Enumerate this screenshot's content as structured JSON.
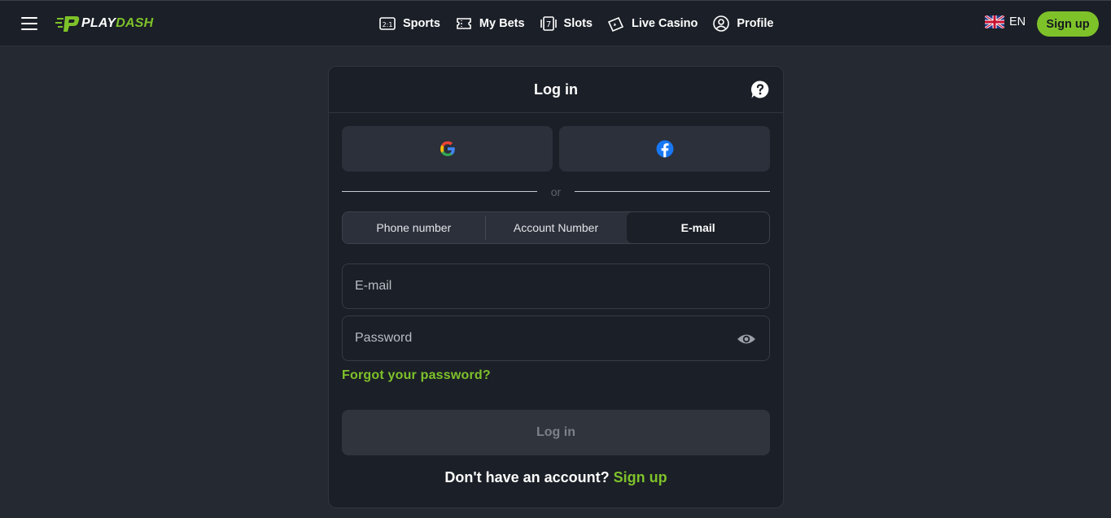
{
  "header": {
    "logo_text_play": "PLAY",
    "logo_text_dash": "DASH",
    "nav": [
      {
        "label": "Sports",
        "icon": "sports-icon"
      },
      {
        "label": "My Bets",
        "icon": "ticket-icon"
      },
      {
        "label": "Slots",
        "icon": "slots-icon"
      },
      {
        "label": "Live Casino",
        "icon": "cards-icon"
      },
      {
        "label": "Profile",
        "icon": "profile-icon"
      }
    ],
    "language": "EN",
    "signup_label": "Sign up"
  },
  "login": {
    "title": "Log in",
    "or_label": "or",
    "tabs": [
      {
        "label": "Phone number",
        "active": false
      },
      {
        "label": "Account Number",
        "active": false
      },
      {
        "label": "E-mail",
        "active": true
      }
    ],
    "email_placeholder": "E-mail",
    "email_value": "",
    "password_placeholder": "Password",
    "password_value": "",
    "forgot_label": "Forgot your password?",
    "submit_label": "Log in",
    "no_account_text": "Don't have an account?",
    "signup_link": "Sign up"
  },
  "colors": {
    "accent": "#7ec22a",
    "background": "#242932",
    "card": "#1b1f27",
    "button_disabled": "#2f343d"
  }
}
